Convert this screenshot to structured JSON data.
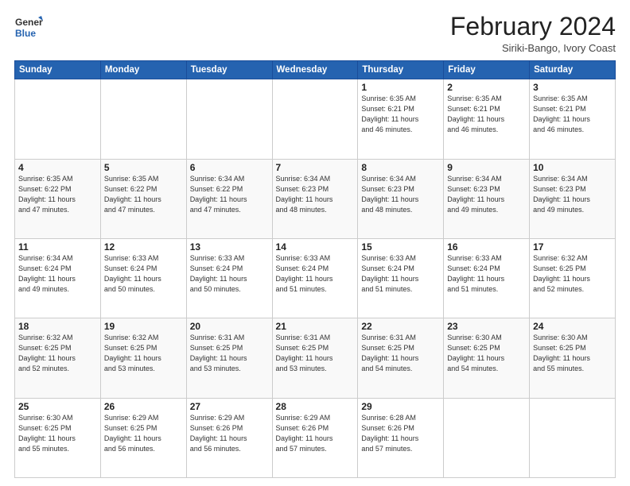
{
  "header": {
    "logo_general": "General",
    "logo_blue": "Blue",
    "month_year": "February 2024",
    "location": "Siriki-Bango, Ivory Coast"
  },
  "weekdays": [
    "Sunday",
    "Monday",
    "Tuesday",
    "Wednesday",
    "Thursday",
    "Friday",
    "Saturday"
  ],
  "weeks": [
    [
      {
        "day": "",
        "info": ""
      },
      {
        "day": "",
        "info": ""
      },
      {
        "day": "",
        "info": ""
      },
      {
        "day": "",
        "info": ""
      },
      {
        "day": "1",
        "info": "Sunrise: 6:35 AM\nSunset: 6:21 PM\nDaylight: 11 hours\nand 46 minutes."
      },
      {
        "day": "2",
        "info": "Sunrise: 6:35 AM\nSunset: 6:21 PM\nDaylight: 11 hours\nand 46 minutes."
      },
      {
        "day": "3",
        "info": "Sunrise: 6:35 AM\nSunset: 6:21 PM\nDaylight: 11 hours\nand 46 minutes."
      }
    ],
    [
      {
        "day": "4",
        "info": "Sunrise: 6:35 AM\nSunset: 6:22 PM\nDaylight: 11 hours\nand 47 minutes."
      },
      {
        "day": "5",
        "info": "Sunrise: 6:35 AM\nSunset: 6:22 PM\nDaylight: 11 hours\nand 47 minutes."
      },
      {
        "day": "6",
        "info": "Sunrise: 6:34 AM\nSunset: 6:22 PM\nDaylight: 11 hours\nand 47 minutes."
      },
      {
        "day": "7",
        "info": "Sunrise: 6:34 AM\nSunset: 6:23 PM\nDaylight: 11 hours\nand 48 minutes."
      },
      {
        "day": "8",
        "info": "Sunrise: 6:34 AM\nSunset: 6:23 PM\nDaylight: 11 hours\nand 48 minutes."
      },
      {
        "day": "9",
        "info": "Sunrise: 6:34 AM\nSunset: 6:23 PM\nDaylight: 11 hours\nand 49 minutes."
      },
      {
        "day": "10",
        "info": "Sunrise: 6:34 AM\nSunset: 6:23 PM\nDaylight: 11 hours\nand 49 minutes."
      }
    ],
    [
      {
        "day": "11",
        "info": "Sunrise: 6:34 AM\nSunset: 6:24 PM\nDaylight: 11 hours\nand 49 minutes."
      },
      {
        "day": "12",
        "info": "Sunrise: 6:33 AM\nSunset: 6:24 PM\nDaylight: 11 hours\nand 50 minutes."
      },
      {
        "day": "13",
        "info": "Sunrise: 6:33 AM\nSunset: 6:24 PM\nDaylight: 11 hours\nand 50 minutes."
      },
      {
        "day": "14",
        "info": "Sunrise: 6:33 AM\nSunset: 6:24 PM\nDaylight: 11 hours\nand 51 minutes."
      },
      {
        "day": "15",
        "info": "Sunrise: 6:33 AM\nSunset: 6:24 PM\nDaylight: 11 hours\nand 51 minutes."
      },
      {
        "day": "16",
        "info": "Sunrise: 6:33 AM\nSunset: 6:24 PM\nDaylight: 11 hours\nand 51 minutes."
      },
      {
        "day": "17",
        "info": "Sunrise: 6:32 AM\nSunset: 6:25 PM\nDaylight: 11 hours\nand 52 minutes."
      }
    ],
    [
      {
        "day": "18",
        "info": "Sunrise: 6:32 AM\nSunset: 6:25 PM\nDaylight: 11 hours\nand 52 minutes."
      },
      {
        "day": "19",
        "info": "Sunrise: 6:32 AM\nSunset: 6:25 PM\nDaylight: 11 hours\nand 53 minutes."
      },
      {
        "day": "20",
        "info": "Sunrise: 6:31 AM\nSunset: 6:25 PM\nDaylight: 11 hours\nand 53 minutes."
      },
      {
        "day": "21",
        "info": "Sunrise: 6:31 AM\nSunset: 6:25 PM\nDaylight: 11 hours\nand 53 minutes."
      },
      {
        "day": "22",
        "info": "Sunrise: 6:31 AM\nSunset: 6:25 PM\nDaylight: 11 hours\nand 54 minutes."
      },
      {
        "day": "23",
        "info": "Sunrise: 6:30 AM\nSunset: 6:25 PM\nDaylight: 11 hours\nand 54 minutes."
      },
      {
        "day": "24",
        "info": "Sunrise: 6:30 AM\nSunset: 6:25 PM\nDaylight: 11 hours\nand 55 minutes."
      }
    ],
    [
      {
        "day": "25",
        "info": "Sunrise: 6:30 AM\nSunset: 6:25 PM\nDaylight: 11 hours\nand 55 minutes."
      },
      {
        "day": "26",
        "info": "Sunrise: 6:29 AM\nSunset: 6:25 PM\nDaylight: 11 hours\nand 56 minutes."
      },
      {
        "day": "27",
        "info": "Sunrise: 6:29 AM\nSunset: 6:26 PM\nDaylight: 11 hours\nand 56 minutes."
      },
      {
        "day": "28",
        "info": "Sunrise: 6:29 AM\nSunset: 6:26 PM\nDaylight: 11 hours\nand 57 minutes."
      },
      {
        "day": "29",
        "info": "Sunrise: 6:28 AM\nSunset: 6:26 PM\nDaylight: 11 hours\nand 57 minutes."
      },
      {
        "day": "",
        "info": ""
      },
      {
        "day": "",
        "info": ""
      }
    ]
  ]
}
